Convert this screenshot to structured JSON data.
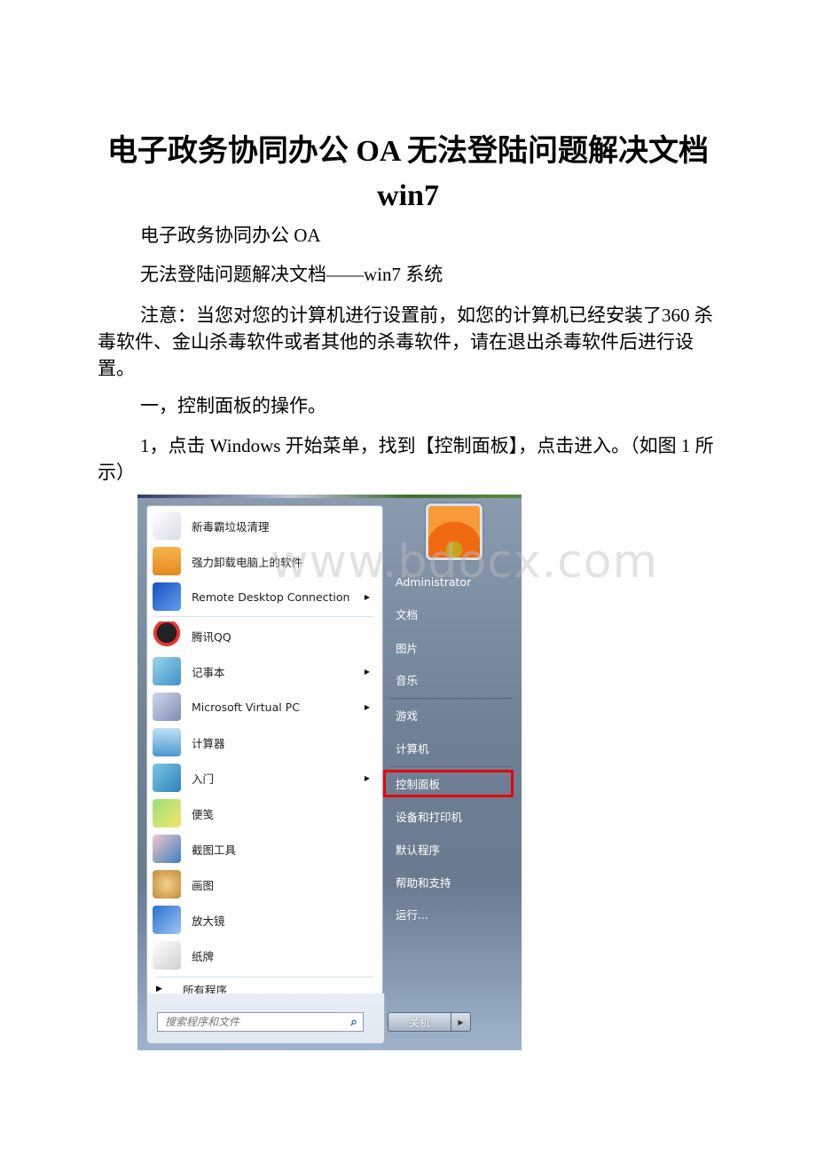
{
  "document": {
    "title_line1": "电子政务协同办公 OA 无法登陆问题解决文档",
    "title_line2": "win7",
    "paragraphs": [
      "电子政务协同办公 OA",
      "无法登陆问题解决文档——win7 系统",
      "注意：当您对您的计算机进行设置前，如您的计算机已经安装了360 杀毒软件、金山杀毒软件或者其他的杀毒软件，请在退出杀毒软件后进行设置。",
      "一，控制面板的操作。",
      "1，点击 Windows 开始菜单，找到【控制面板】，点击进入。（如图 1 所示）"
    ]
  },
  "start_menu": {
    "programs": [
      {
        "label": "新毒霸垃圾清理",
        "icon": "cleaner-icon",
        "submenu": false
      },
      {
        "label": "强力卸载电脑上的软件",
        "icon": "uninstall-box-icon",
        "submenu": false
      },
      {
        "label": "Remote Desktop Connection",
        "icon": "remote-desktop-icon",
        "submenu": true
      },
      {
        "label": "腾讯QQ",
        "icon": "qq-penguin-icon",
        "submenu": false
      },
      {
        "label": "记事本",
        "icon": "notepad-icon",
        "submenu": true
      },
      {
        "label": "Microsoft Virtual PC",
        "icon": "virtual-pc-icon",
        "submenu": true
      },
      {
        "label": "计算器",
        "icon": "calculator-icon",
        "submenu": false
      },
      {
        "label": "入门",
        "icon": "getting-started-icon",
        "submenu": true
      },
      {
        "label": "便笺",
        "icon": "sticky-notes-icon",
        "submenu": false
      },
      {
        "label": "截图工具",
        "icon": "snipping-tool-icon",
        "submenu": false
      },
      {
        "label": "画图",
        "icon": "paint-palette-icon",
        "submenu": false
      },
      {
        "label": "放大镜",
        "icon": "magnifier-icon",
        "submenu": false
      },
      {
        "label": "纸牌",
        "icon": "solitaire-icon",
        "submenu": false
      }
    ],
    "all_programs": "所有程序",
    "search_placeholder": "搜索程序和文件",
    "user_name": "Administrator",
    "right_items": [
      "文档",
      "图片",
      "音乐",
      "游戏",
      "计算机",
      "控制面板",
      "设备和打印机",
      "默认程序",
      "帮助和支持",
      "运行..."
    ],
    "highlighted_item": "控制面板",
    "shutdown_label": "关机",
    "highlight_color": "#e8000a"
  },
  "watermark": "www.bdocx.com"
}
